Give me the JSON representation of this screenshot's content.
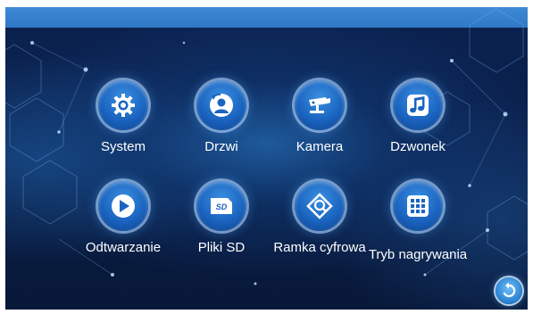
{
  "menu": {
    "row1": [
      {
        "label": "System",
        "icon": "gear-icon"
      },
      {
        "label": "Drzwi",
        "icon": "door-user-icon"
      },
      {
        "label": "Kamera",
        "icon": "cctv-camera-icon"
      },
      {
        "label": "Dzwonek",
        "icon": "music-note-icon"
      }
    ],
    "row2": [
      {
        "label": "Odtwarzanie",
        "icon": "play-icon"
      },
      {
        "label": "Pliki SD",
        "icon": "sd-card-icon"
      },
      {
        "label": "Ramka cyfrowa",
        "icon": "photo-frame-icon"
      },
      {
        "label": "Tryb nagrywania",
        "icon": "grid-icon"
      }
    ]
  },
  "back_button": {
    "icon": "back-arrow-icon"
  },
  "colors": {
    "top_bar": "#3d8ad6",
    "background": "#0a1f4a",
    "icon_bg": "#1a64c0"
  }
}
